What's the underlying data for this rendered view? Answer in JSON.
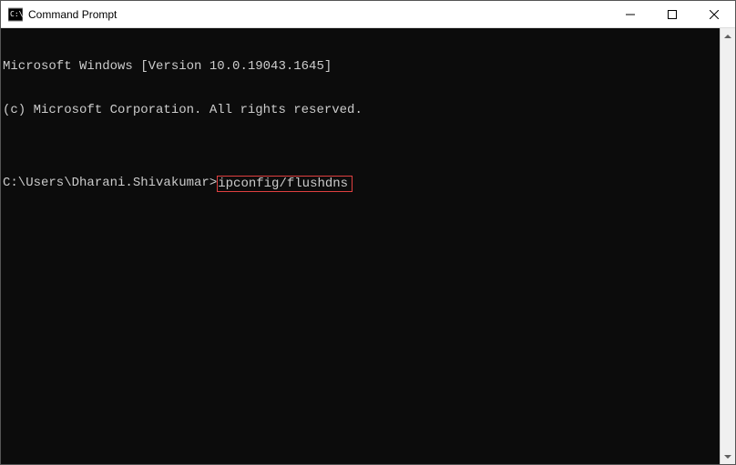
{
  "window": {
    "title": "Command Prompt"
  },
  "terminal": {
    "line1": "Microsoft Windows [Version 10.0.19043.1645]",
    "line2": "(c) Microsoft Corporation. All rights reserved.",
    "blank": "",
    "prompt": "C:\\Users\\Dharani.Shivakumar>",
    "command": "ipconfig/flushdns"
  }
}
